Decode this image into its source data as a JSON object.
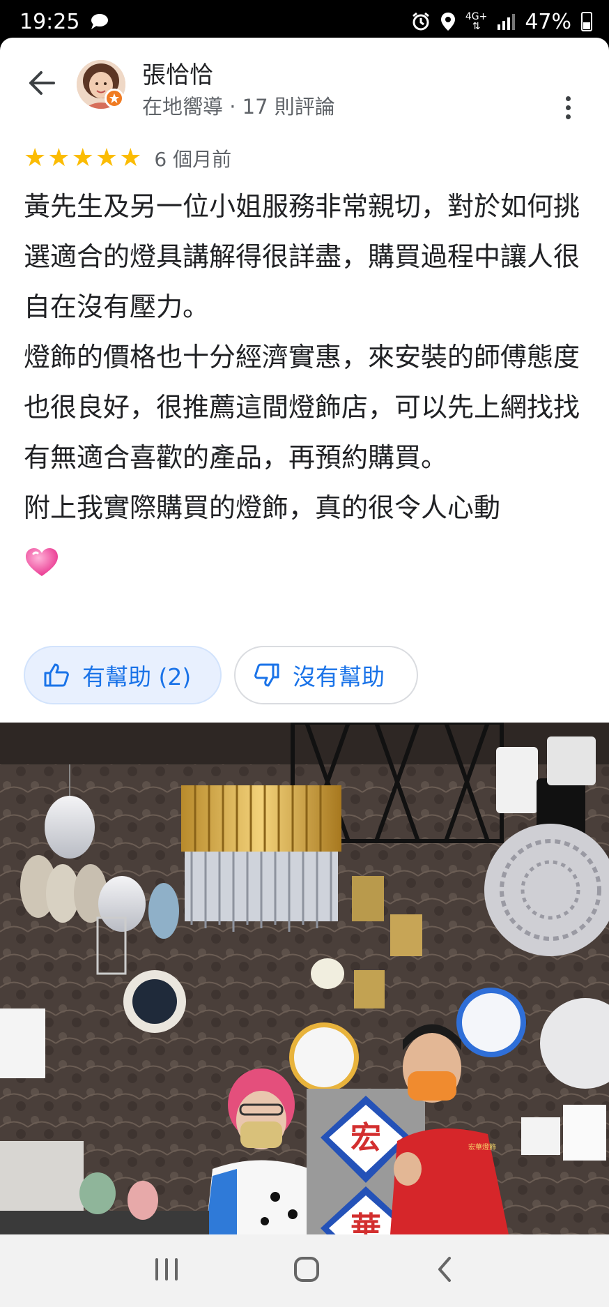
{
  "status_bar": {
    "time": "19:25",
    "network": "4G+",
    "battery": "47%"
  },
  "reviewer": {
    "name": "張恰恰",
    "meta": "在地嚮導 · 17 則評論"
  },
  "review": {
    "rating": 5,
    "date": "6 個月前",
    "paragraphs": [
      "黃先生及另一位小姐服務非常親切，對於如何挑選適合的燈具講解得很詳盡，購買過程中讓人很自在沒有壓力。",
      "燈飾的價格也十分經濟實惠，來安裝的師傅態度也很良好，很推薦這間燈飾店，可以先上網找找有無適合喜歡的產品，再預約購買。",
      "附上我實際購買的燈飾，真的很令人心動"
    ]
  },
  "actions": {
    "helpful": "有幫助 (2)",
    "not_helpful": "沒有幫助"
  },
  "photo": {
    "sign_top": "宏",
    "sign_bottom": "華",
    "shirt_text": "宏華燈飾"
  },
  "colors": {
    "star": "#fbbc04",
    "accent": "#1a73e8",
    "helpful_bg": "#e8f0fe"
  }
}
